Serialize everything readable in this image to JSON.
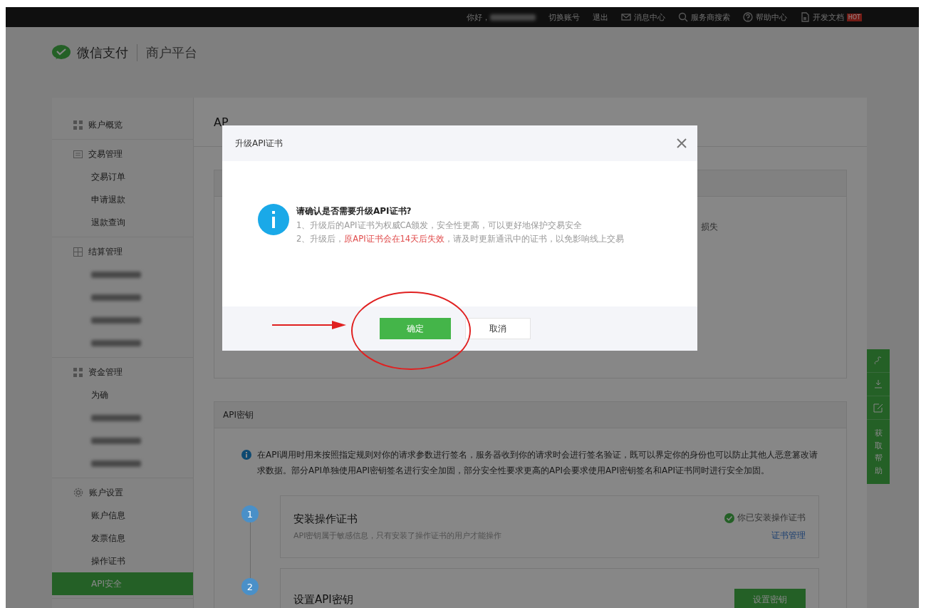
{
  "top_bar": {
    "greeting": "你好，",
    "links": [
      {
        "label": "切换账号",
        "kind": "plain"
      },
      {
        "label": "退出",
        "kind": "plain"
      },
      {
        "label": "消息中心",
        "kind": "mail"
      },
      {
        "label": "服务商搜索",
        "kind": "search"
      },
      {
        "label": "帮助中心",
        "kind": "help"
      },
      {
        "label": "开发文档",
        "kind": "doc",
        "badge": "HOT"
      }
    ]
  },
  "header": {
    "brand": "微信支付",
    "product": "商户平台"
  },
  "sidebar": [
    {
      "title": "账户概览"
    },
    {
      "title": "交易管理",
      "items": [
        {
          "kind": "text",
          "label": "交易订单",
          "selected": false
        },
        {
          "kind": "text",
          "label": "申请退款",
          "selected": false
        },
        {
          "kind": "text",
          "label": "退款查询",
          "selected": false
        }
      ]
    },
    {
      "title": "结算管理",
      "items": [
        {
          "kind": "blurred",
          "selected": false
        },
        {
          "kind": "blurred",
          "selected": false
        },
        {
          "kind": "blurred",
          "selected": false
        },
        {
          "kind": "blurred",
          "selected": false
        }
      ]
    },
    {
      "title": "资金管理",
      "items": [
        {
          "kind": "text",
          "label": "为确",
          "selected": false
        },
        {
          "kind": "blurred",
          "selected": false
        },
        {
          "kind": "blurred",
          "selected": false
        },
        {
          "kind": "blurred",
          "selected": false
        }
      ]
    },
    {
      "title": "账户设置",
      "items": [
        {
          "kind": "text",
          "label": "账户信息",
          "selected": false
        },
        {
          "kind": "text",
          "label": "发票信息",
          "selected": false
        },
        {
          "kind": "text",
          "label": "操作证书",
          "selected": false
        },
        {
          "kind": "text",
          "label": "API安全",
          "selected": true
        }
      ]
    }
  ],
  "page_title": "AP",
  "cert_section": {
    "fragment": "损失"
  },
  "key_section": {
    "title": "API密钥",
    "info": "在API调用时用来按照指定规则对你的请求参数进行签名，服务器收到你的请求时会进行签名验证，既可以界定你的身份也可以防止其他人恶意篡改请求数据。部分API单独使用API密钥签名进行安全加固，部分安全性要求更高的API会要求使用API密钥签名和API证书同时进行安全加固。",
    "steps": [
      {
        "number": "1",
        "title": "安装操作证书",
        "desc": "API密钥属于敏感信息，只有安装了操作证书的用户才能操作",
        "status": "你已安装操作证书",
        "link": "证书管理",
        "done": true
      },
      {
        "number": "2",
        "title": "设置API密钥",
        "button": "设置密钥"
      }
    ]
  },
  "help_bar": {
    "label": "获取帮助"
  },
  "dialog": {
    "title": "升级API证书",
    "question": "请确认是否需要升级API证书?",
    "lines": [
      [
        {
          "text": "1、升级后的API证书为权威CA颁发，安全性更高，可以更好地保护交易安全",
          "highlight": false
        }
      ],
      [
        {
          "text": "2、升级后，",
          "highlight": false
        },
        {
          "text": "原API证书会在14天后失效",
          "highlight": true
        },
        {
          "text": "，请及时更新通讯中的证书，以免影响线上交易",
          "highlight": false
        }
      ]
    ],
    "buttons": [
      {
        "label": "确定",
        "primary": true
      },
      {
        "label": "取消",
        "primary": false
      }
    ]
  }
}
